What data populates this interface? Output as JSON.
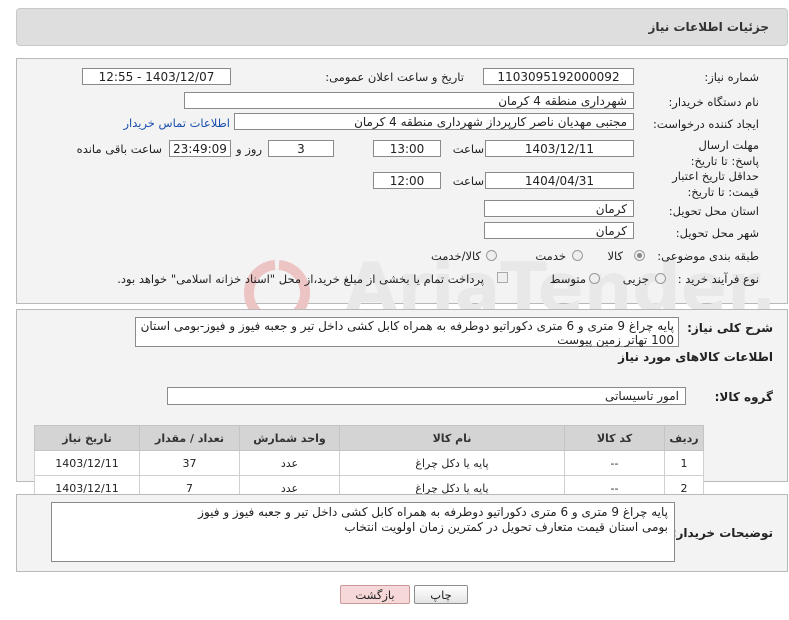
{
  "header": {
    "title": "جزئیات اطلاعات نیاز"
  },
  "form": {
    "need_number_label": "شماره نیاز:",
    "need_number": "1103095192000092",
    "announce_datetime_label": "تاریخ و ساعت اعلان عمومی:",
    "announce_datetime": "1403/12/07 - 12:55",
    "buyer_org_label": "نام دستگاه خریدار:",
    "buyer_org": "شهرداری منطقه 4 کرمان",
    "creator_label": "ایجاد کننده درخواست:",
    "creator": "مجتبی مهدیان ناصر کارپرداز شهرداری منطقه 4 کرمان",
    "buyer_contact_link": "اطلاعات تماس خریدار",
    "reply_deadline_label": "مهلت ارسال پاسخ: تا تاریخ:",
    "reply_date": "1403/12/11",
    "time_label": "ساعت",
    "reply_time": "13:00",
    "days": "3",
    "days_and_label": "روز و",
    "remaining_time": "23:49:09",
    "remaining_label": "ساعت باقی مانده",
    "price_validity_label": "حداقل تاریخ اعتبار قیمت: تا تاریخ:",
    "validity_date": "1404/04/31",
    "validity_time": "12:00",
    "province_label": "استان محل تحویل:",
    "province": "کرمان",
    "city_label": "شهر محل تحویل:",
    "city": "کرمان",
    "category_label": "طبقه بندی موضوعی:",
    "category_options": [
      "کالا",
      "خدمت",
      "کالا/خدمت"
    ],
    "process_label": "نوع فرآیند خرید :",
    "process_options": [
      "جزیی",
      "متوسط"
    ],
    "payment_note": "پرداخت تمام یا بخشی از مبلغ خرید،از محل \"اسناد خزانه اسلامی\" خواهد بود."
  },
  "summary": {
    "label": "شرح کلی نیاز:",
    "text": "پایه چراغ 9 متری و 6 متری دکوراتیو دوطرفه به همراه کابل کشی داخل تیر و جعبه فیوز و فیوز-بومی استان 100 تهاتر زمین پیوست"
  },
  "goods_section": {
    "title": "اطلاعات کالاهای مورد نیاز",
    "group_label": "گروه کالا:",
    "group_value": "امور تاسیساتی"
  },
  "table": {
    "headers": [
      "ردیف",
      "کد کالا",
      "نام کالا",
      "واحد شمارش",
      "تعداد / مقدار",
      "تاریخ نیاز"
    ],
    "rows": [
      [
        "1",
        "--",
        "پایه یا دکل چراغ",
        "عدد",
        "37",
        "1403/12/11"
      ],
      [
        "2",
        "--",
        "پایه یا دکل چراغ",
        "عدد",
        "7",
        "1403/12/11"
      ]
    ]
  },
  "buyer_notes": {
    "label": "توضیحات خریدار:",
    "line1": "پایه چراغ 9 متری و 6 متری دکوراتیو دوطرفه به همراه کابل کشی داخل تیر و جعبه فیوز و فیوز",
    "line2": "بومی استان قیمت متعارف تحویل در کمترین زمان اولویت انتخاب"
  },
  "buttons": {
    "print": "چاپ",
    "back": "بازگشت"
  },
  "watermark": {
    "text": "AriaTender.neT",
    "color": "#e6e6e6",
    "accent": "#e9b9b9"
  }
}
